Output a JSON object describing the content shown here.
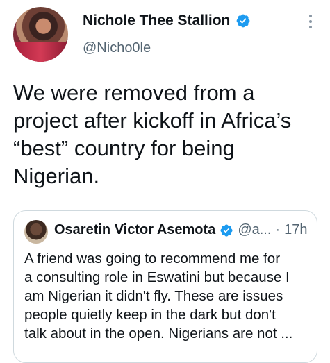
{
  "tweet": {
    "author_name": "Nichole Thee Stallion",
    "author_handle": "@Nicho0le",
    "text": "We were removed from a\nproject after kickoff in Africa’s\n“best” country for being\nNigerian."
  },
  "quoted_tweet": {
    "author_name": "Osaretin Victor Asemota",
    "author_handle": "@a...",
    "separator": "·",
    "time": "17h",
    "text": "A friend was going to recommend me for\na consulting role in Eswatini but because I\nam Nigerian it didn't fly. These are issues\npeople quietly keep in the dark but don't\ntalk about in the open. Nigerians are not ..."
  },
  "colors": {
    "verified": "#1d9bf0",
    "secondary_text": "#536471",
    "border": "#cfd9de"
  },
  "icons": [
    "verified-badge-icon",
    "more-options-icon"
  ]
}
